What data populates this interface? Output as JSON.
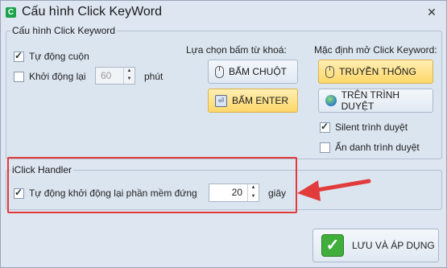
{
  "window": {
    "title": "Cấu hình Click KeyWord",
    "close_symbol": "✕",
    "app_icon_glyph": "C"
  },
  "group_config": {
    "legend": "Cấu hình Click Keyword",
    "auto_scroll": {
      "label": "Tự động cuộn",
      "checked": true
    },
    "auto_restart": {
      "label": "Khởi động lại",
      "checked": false,
      "value": "60",
      "unit": "phút"
    },
    "keyword_click_label": "Lựa chọn bấm từ khoá:",
    "mouse_click_button": "BẤM CHUỘT",
    "enter_button": "BẤM ENTER",
    "default_open_label": "Mặc định mở Click Keyword:",
    "traditional_button": "TRUYỀN THỐNG",
    "browser_button": "TRÊN TRÌNH DUYỆT",
    "silent_browser": {
      "label": "Silent trình duyệt",
      "checked": true
    },
    "incognito_browser": {
      "label": "Ẩn danh trình duyệt",
      "checked": false
    }
  },
  "group_handler": {
    "legend": "iClick Handler",
    "auto_restart_on_hang": {
      "label": "Tự động khởi động lại phần mềm đứng",
      "checked": true
    },
    "seconds_value": "20",
    "seconds_unit": "giây"
  },
  "save_button": {
    "label": "LƯU VÀ ÁP DỤNG"
  },
  "colors": {
    "annotation_red": "#e23b3b",
    "accent_yellow": "#fdd76a",
    "window_bg": "#dde6f1"
  }
}
